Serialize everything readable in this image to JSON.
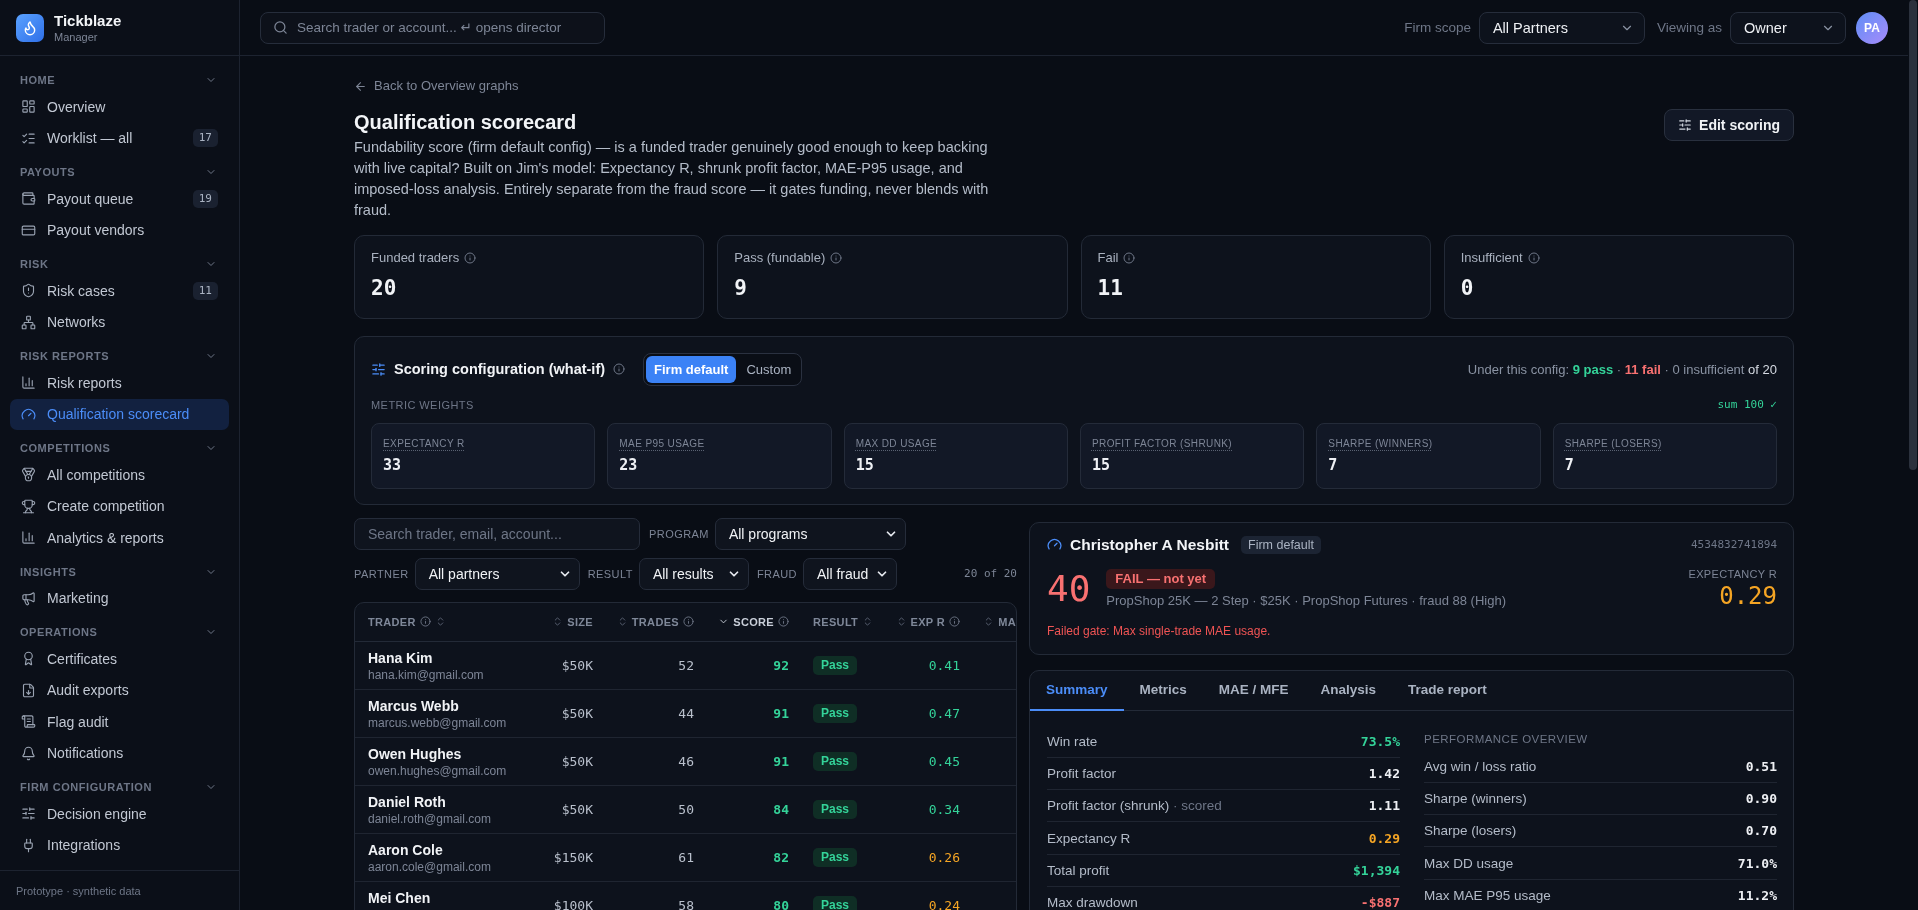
{
  "app": {
    "name": "Tickblaze",
    "subtitle": "Manager"
  },
  "sidebar": {
    "sections": [
      {
        "title": "HOME",
        "expanded": true,
        "items": [
          {
            "label": "Overview",
            "selected": false
          },
          {
            "label": "Worklist — all",
            "selected": false,
            "count": "17"
          }
        ]
      },
      {
        "title": "PAYOUTS",
        "expanded": true,
        "items": [
          {
            "label": "Payout queue",
            "selected": false,
            "count": "19"
          },
          {
            "label": "Payout vendors",
            "selected": false
          }
        ]
      },
      {
        "title": "RISK",
        "expanded": true,
        "items": [
          {
            "label": "Risk cases",
            "selected": false,
            "count": "11"
          },
          {
            "label": "Networks",
            "selected": false
          }
        ]
      },
      {
        "title": "RISK REPORTS",
        "expanded": true,
        "items": [
          {
            "label": "Risk reports",
            "selected": false
          },
          {
            "label": "Qualification scorecard",
            "selected": true
          }
        ]
      },
      {
        "title": "COMPETITIONS",
        "expanded": true,
        "items": [
          {
            "label": "All competitions",
            "selected": false
          },
          {
            "label": "Create competition",
            "selected": false
          },
          {
            "label": "Analytics & reports",
            "selected": false
          }
        ]
      },
      {
        "title": "INSIGHTS",
        "expanded": true,
        "items": [
          {
            "label": "Marketing",
            "selected": false
          }
        ]
      },
      {
        "title": "OPERATIONS",
        "expanded": true,
        "items": [
          {
            "label": "Certificates",
            "selected": false
          },
          {
            "label": "Audit exports",
            "selected": false
          },
          {
            "label": "Flag audit",
            "selected": false
          },
          {
            "label": "Notifications",
            "selected": false
          }
        ]
      },
      {
        "title": "FIRM CONFIGURATION",
        "expanded": true,
        "items": [
          {
            "label": "Decision engine",
            "selected": false
          },
          {
            "label": "Integrations",
            "selected": false
          }
        ]
      }
    ],
    "footer": "Prototype · synthetic data"
  },
  "topbar": {
    "search": {
      "placeholder": "Search trader or account... ↵ opens director"
    },
    "firm_scope": {
      "label": "Firm scope",
      "value": "All Partners"
    },
    "viewing_as": {
      "label": "Viewing as",
      "value": "Owner"
    },
    "avatar": {
      "initials": "PA"
    }
  },
  "page": {
    "back_link": "Back to Overview graphs",
    "title": "Qualification scorecard",
    "description": "Fundability score (firm default config) — is a funded trader genuinely good enough to keep backing with live capital? Built on Jim's model: Expectancy R, shrunk profit factor, MAE-P95 usage, and imposed-loss analysis. Entirely separate from the fraud score — it gates funding, never blends with fraud.",
    "edit_button": "Edit scoring"
  },
  "stats": [
    {
      "label": "Funded traders",
      "value": "20"
    },
    {
      "label": "Pass (fundable)",
      "value": "9"
    },
    {
      "label": "Fail",
      "value": "11"
    },
    {
      "label": "Insufficient",
      "value": "0"
    }
  ],
  "scoring_config": {
    "title": "Scoring configuration (what-if)",
    "modes": [
      {
        "label": "Firm default",
        "selected": true
      },
      {
        "label": "Custom",
        "selected": false
      }
    ],
    "summary": [
      {
        "kind": "text",
        "text": "Under this config:"
      },
      {
        "kind": "pass",
        "text": "9 pass"
      },
      {
        "kind": "text",
        "text": "·"
      },
      {
        "kind": "fail",
        "text": "11 fail"
      },
      {
        "kind": "text",
        "text": "· 0 insufficient"
      },
      {
        "kind": "total",
        "text": "of 20"
      }
    ],
    "weights_label": "METRIC WEIGHTS",
    "weights_sum": "sum 100 ✓",
    "weights": [
      {
        "label": "EXPECTANCY R",
        "value": "33"
      },
      {
        "label": "MAE P95 USAGE",
        "value": "23"
      },
      {
        "label": "MAX DD USAGE",
        "value": "15"
      },
      {
        "label": "PROFIT FACTOR (SHRUNK)",
        "value": "15"
      },
      {
        "label": "SHARPE (WINNERS)",
        "value": "7"
      },
      {
        "label": "SHARPE (LOSERS)",
        "value": "7"
      }
    ]
  },
  "filters": {
    "search": {
      "placeholder": "Search trader, email, account..."
    },
    "selects": [
      {
        "label": "PROGRAM",
        "value": "All programs"
      },
      {
        "label": "PARTNER",
        "value": "All partners"
      },
      {
        "label": "RESULT",
        "value": "All results"
      },
      {
        "label": "FRAUD",
        "value": "All fraud"
      }
    ],
    "count": "20 of 20"
  },
  "table": {
    "columns": [
      {
        "label": "TRADER",
        "kind": "text",
        "info": true,
        "sorted": false
      },
      {
        "label": "SIZE",
        "kind": "number",
        "info": false,
        "sorted": false
      },
      {
        "label": "TRADES",
        "kind": "number",
        "info": true,
        "sorted": false
      },
      {
        "label": "SCORE",
        "kind": "number",
        "info": true,
        "sorted": true
      },
      {
        "label": "RESULT",
        "kind": "text",
        "info": false,
        "sorted": false
      },
      {
        "label": "EXP R",
        "kind": "number",
        "info": true,
        "sorted": false
      },
      {
        "label": "MA",
        "kind": "number",
        "info": false,
        "sorted": false
      }
    ],
    "rows": [
      {
        "name": "Hana Kim",
        "email": "hana.kim@gmail.com",
        "size": "$50K",
        "trades": "52",
        "score": "92",
        "result": "Pass",
        "passed": true,
        "exp_r": {
          "value": "0.41",
          "color": "#34d399"
        },
        "selected": false
      },
      {
        "name": "Marcus Webb",
        "email": "marcus.webb@gmail.com",
        "size": "$50K",
        "trades": "44",
        "score": "91",
        "result": "Pass",
        "passed": true,
        "exp_r": {
          "value": "0.47",
          "color": "#34d399"
        },
        "selected": false
      },
      {
        "name": "Owen Hughes",
        "email": "owen.hughes@gmail.com",
        "size": "$50K",
        "trades": "46",
        "score": "91",
        "result": "Pass",
        "passed": true,
        "exp_r": {
          "value": "0.45",
          "color": "#34d399"
        },
        "selected": false
      },
      {
        "name": "Daniel Roth",
        "email": "daniel.roth@gmail.com",
        "size": "$50K",
        "trades": "50",
        "score": "84",
        "result": "Pass",
        "passed": true,
        "exp_r": {
          "value": "0.34",
          "color": "#34d399"
        },
        "selected": false
      },
      {
        "name": "Aaron Cole",
        "email": "aaron.cole@gmail.com",
        "size": "$150K",
        "trades": "61",
        "score": "82",
        "result": "Pass",
        "passed": true,
        "exp_r": {
          "value": "0.26",
          "color": "#f5a524"
        },
        "selected": false
      },
      {
        "name": "Mei Chen",
        "size": "$100K",
        "trades": "58",
        "score": "80",
        "result": "Pass",
        "passed": true,
        "exp_r": {
          "value": "0.24",
          "color": "#f5a524"
        },
        "selected": false
      }
    ]
  },
  "trader_detail": {
    "name": "Christopher A Nesbitt",
    "config_tag": "Firm default",
    "account_id": "4534832741894",
    "score": "40",
    "result": "FAIL — not yet",
    "passed": false,
    "meta": "PropShop 25K — 2 Step · $25K · PropShop Futures · fraud 88 (High)",
    "gate_message": "Failed gate: Max single-trade MAE usage.",
    "metric": {
      "label": "EXPECTANCY R",
      "value": "0.29",
      "color": "#f5a524"
    }
  },
  "detail_tabs": [
    {
      "label": "Summary",
      "selected": true
    },
    {
      "label": "Metrics",
      "selected": false
    },
    {
      "label": "MAE / MFE",
      "selected": false
    },
    {
      "label": "Analysis",
      "selected": false
    },
    {
      "label": "Trade report",
      "selected": false
    }
  ],
  "summary": {
    "left": [
      {
        "label": "Win rate",
        "value": "73.5%",
        "color": "#34d399"
      },
      {
        "label": "Profit factor",
        "value": "1.42",
        "color": "#eef0f4"
      },
      {
        "label": "Profit factor (shrunk)",
        "note": "· scored",
        "value": "1.11",
        "color": "#eef0f4"
      },
      {
        "label": "Expectancy R",
        "value": "0.29",
        "color": "#f5a524"
      },
      {
        "label": "Total profit",
        "value": "$1,394",
        "color": "#34d399"
      },
      {
        "label": "Max drawdown",
        "value": "-$887",
        "color": "#f87171"
      }
    ],
    "right_title": "PERFORMANCE OVERVIEW",
    "right": [
      {
        "label": "Avg win / loss ratio",
        "value": "0.51",
        "color": "#eef0f4"
      },
      {
        "label": "Sharpe (winners)",
        "value": "0.90",
        "color": "#eef0f4"
      },
      {
        "label": "Sharpe (losers)",
        "value": "0.70",
        "color": "#eef0f4"
      },
      {
        "label": "Max DD usage",
        "value": "71.0%",
        "color": "#eef0f4"
      },
      {
        "label": "Max MAE P95 usage",
        "value": "11.2%",
        "color": "#eef0f4"
      }
    ]
  }
}
